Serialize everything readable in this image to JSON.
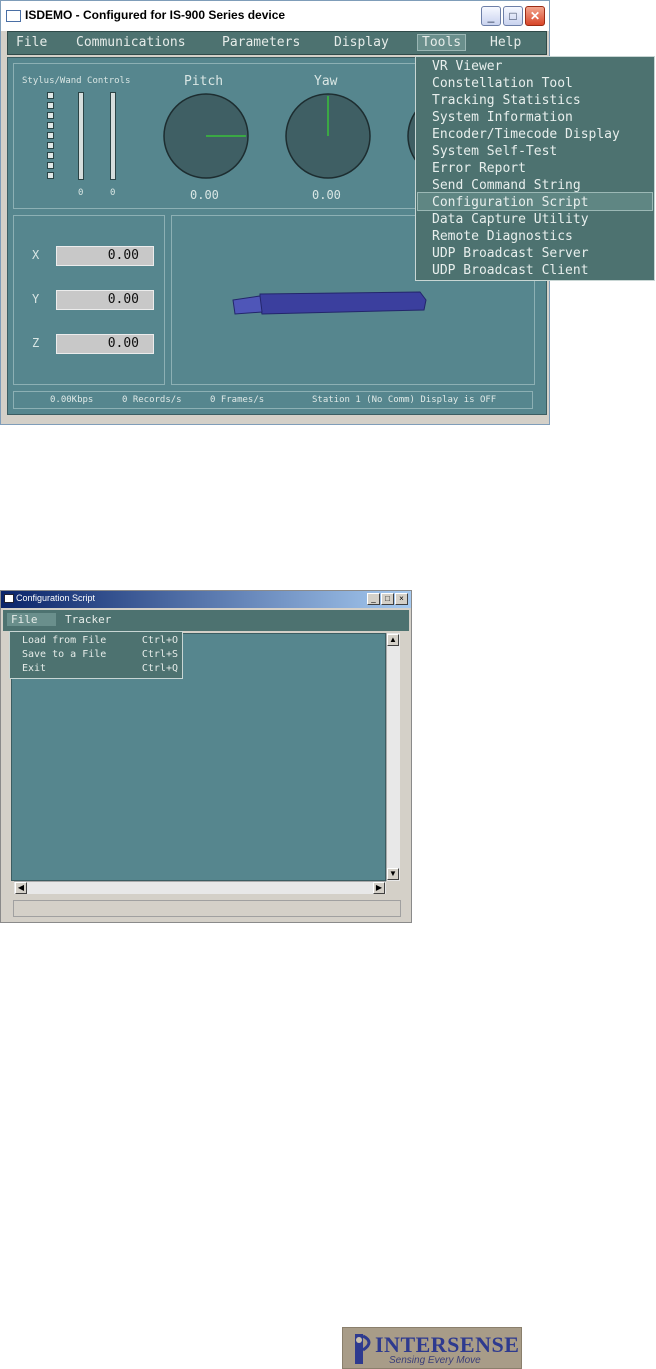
{
  "window1": {
    "title": "ISDEMO - Configured for IS-900 Series device",
    "menu": [
      "File",
      "Communications",
      "Parameters",
      "Display",
      "Tools",
      "Help"
    ],
    "stylus_label": "Stylus/Wand Controls",
    "stylus_values": [
      "0",
      "0"
    ],
    "gauges": [
      {
        "label": "Pitch",
        "value": "0.00"
      },
      {
        "label": "Yaw",
        "value": "0.00"
      }
    ],
    "position": [
      {
        "axis": "X",
        "value": "0.00"
      },
      {
        "axis": "Y",
        "value": "0.00"
      },
      {
        "axis": "Z",
        "value": "0.00"
      }
    ],
    "tools_menu": [
      "VR Viewer",
      "Constellation Tool",
      "Tracking Statistics",
      "System Information",
      "Encoder/Timecode Display",
      "System Self-Test",
      "Error Report",
      "Send Command String",
      "Configuration Script",
      "Data Capture Utility",
      "Remote Diagnostics",
      "UDP Broadcast Server",
      "UDP Broadcast Client"
    ],
    "tools_menu_highlighted": "Configuration Script",
    "status": {
      "rate": "0.00Kbps",
      "records": "0 Records/s",
      "frames": "0 Frames/s",
      "station": "Station 1 (No Comm) Display is OFF"
    },
    "colors": {
      "panel": "#56868e",
      "menu": "#4d7270",
      "wand": "#3b3f9e"
    }
  },
  "window2": {
    "title": "Configuration Script",
    "menu": [
      "File",
      "Tracker"
    ],
    "file_menu": [
      {
        "label": "Load from File",
        "shortcut": "Ctrl+O"
      },
      {
        "label": "Save to a File",
        "shortcut": "Ctrl+S"
      },
      {
        "label": "Exit",
        "shortcut": "Ctrl+Q"
      }
    ]
  },
  "logo": {
    "brand": "INTERSENSE",
    "tagline": "Sensing Every Move"
  }
}
